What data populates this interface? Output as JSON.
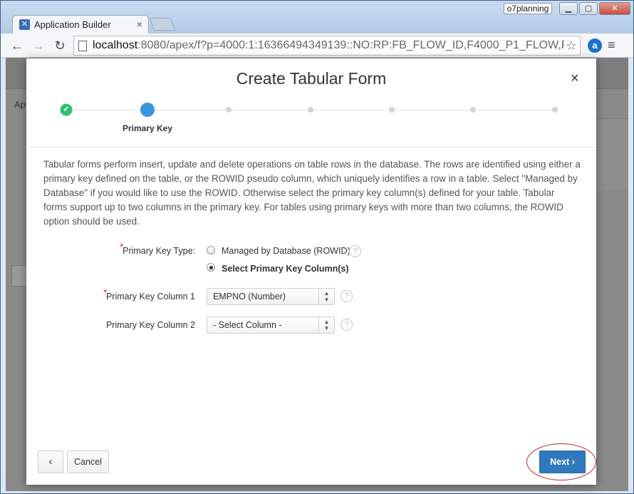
{
  "browser": {
    "tab_title": "Application Builder",
    "user_badge": "o7planning",
    "url_host": "localhost",
    "url_rest": ":8080/apex/f?p=4000:1:16366494349139::NO:RP:FB_FLOW_ID,F4000_P1_FLOW,P0_FLO"
  },
  "background": {
    "label": "Ap"
  },
  "dialog": {
    "title": "Create Tabular Form",
    "close_glyph": "×",
    "wizard": {
      "current_step_label": "Primary Key",
      "total_steps": 7,
      "current_step": 2
    },
    "help_text": "Tabular forms perform insert, update and delete operations on table rows in the database. The rows are identified using either a primary key defined on the table, or the ROWID pseudo column, which uniquely identifies a row in a table. Select \"Managed by Database\" if you would like to use the ROWID. Otherwise select the primary key column(s) defined for your table. Tabular forms support up to two columns in the primary key. For tables using primary keys with more than two columns, the ROWID option should be used.",
    "form": {
      "pk_type_label": "Primary Key Type:",
      "pk_type_options": [
        "Managed by Database (ROWID)",
        "Select Primary Key Column(s)"
      ],
      "pk_type_selected": "Select Primary Key Column(s)",
      "pk_col1_label": "Primary Key Column 1",
      "pk_col1_value": "EMPNO (Number)",
      "pk_col2_label": "Primary Key Column 2",
      "pk_col2_value": "- Select Column -"
    },
    "buttons": {
      "cancel": "Cancel",
      "next": "Next"
    }
  },
  "colors": {
    "primary_button": "#2f78bd",
    "step_done": "#2fbf71",
    "step_current": "#3a96e0",
    "required_asterisk": "#e0312b",
    "annotation_ring": "#c0282e"
  }
}
